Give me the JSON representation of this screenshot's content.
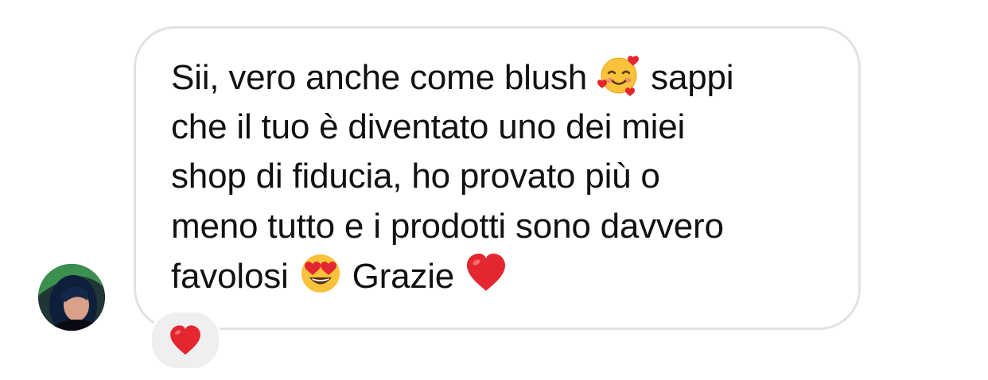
{
  "message": {
    "lines": [
      [
        "Sii, vero anche come blush ",
        "smiling-face-with-hearts-icon",
        "  sappi"
      ],
      [
        "che il tuo è diventato uno dei miei"
      ],
      [
        "shop di fiducia, ho provato più o"
      ],
      [
        "meno tutto e i prodotti sono davvero"
      ],
      [
        "favolosi ",
        "heart-eyes-icon",
        " Grazie ",
        "red-heart-icon"
      ]
    ],
    "line1_text_a": "Sii, vero anche come blush",
    "line1_text_b": "sappi",
    "line2": "che il tuo è diventato uno dei miei",
    "line3": "shop di fiducia, ho provato più o",
    "line4": "meno tutto e i prodotti sono davvero",
    "line5_text_a": "favolosi",
    "line5_text_b": "Grazie"
  },
  "reaction": {
    "icon": "red-heart-icon"
  },
  "colors": {
    "bubble_border": "#e2e2e2",
    "reaction_bg": "#efefef",
    "heart": "#e3262f",
    "text": "#111111"
  }
}
